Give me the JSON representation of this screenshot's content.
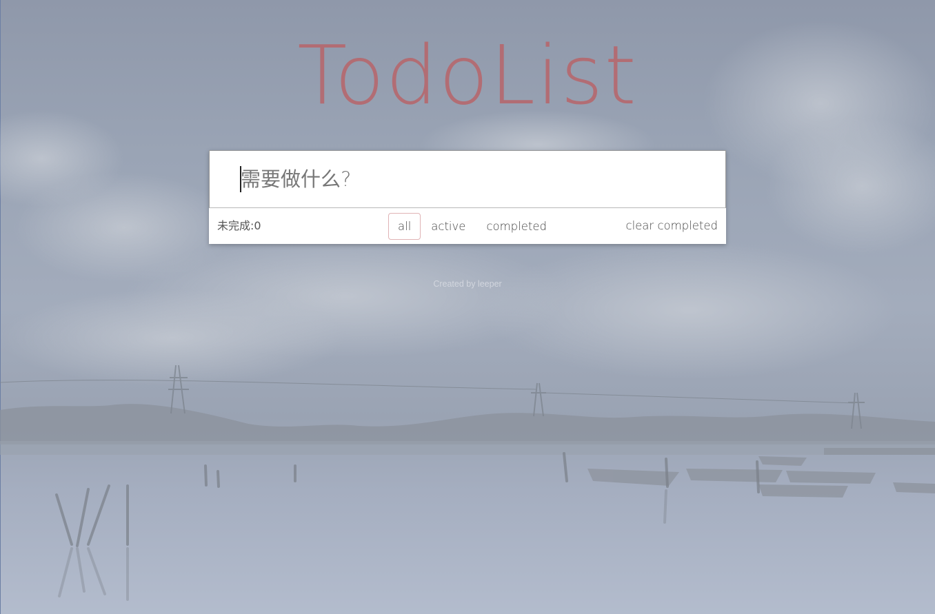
{
  "app": {
    "title": "TodoList"
  },
  "input": {
    "placeholder": "需要做什么?",
    "value": ""
  },
  "footer": {
    "count_label": "未完成:",
    "count_value": "0",
    "filters": [
      {
        "label": "all",
        "selected": true
      },
      {
        "label": "active",
        "selected": false
      },
      {
        "label": "completed",
        "selected": false
      }
    ],
    "clear_label": "clear completed"
  },
  "credit": {
    "text": "Created by leeper"
  },
  "colors": {
    "title": "#b5696f",
    "selected_filter_border": "#e0b3b5",
    "background": "#9aa4b5"
  }
}
